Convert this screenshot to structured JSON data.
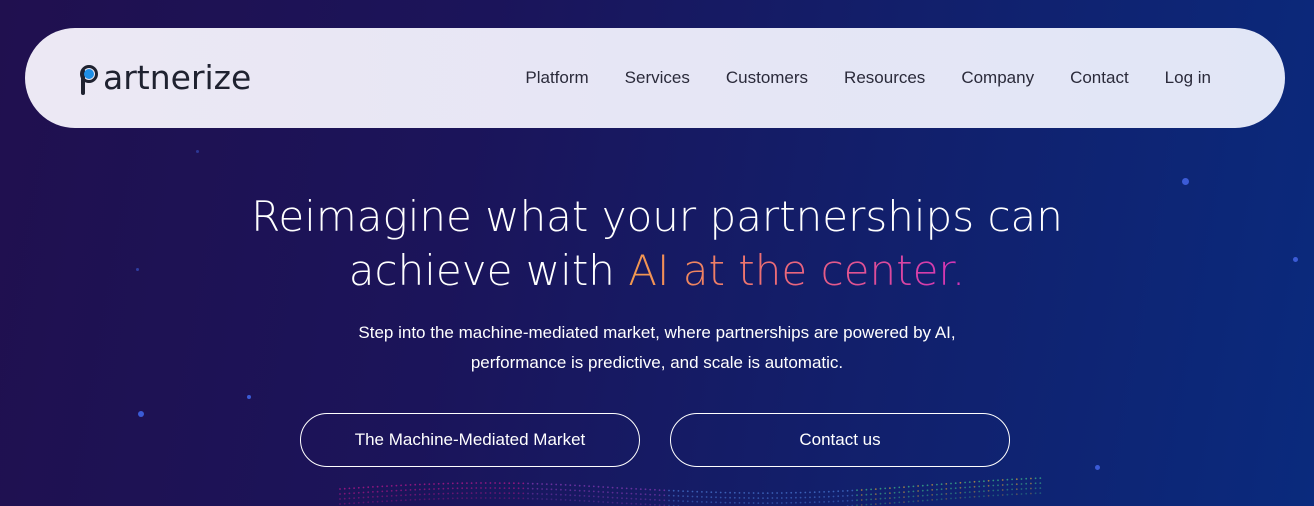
{
  "header": {
    "logo_text": "artnerize",
    "logo_icon": "partnerize-p-logo-icon",
    "nav": [
      {
        "label": "Platform"
      },
      {
        "label": "Services"
      },
      {
        "label": "Customers"
      },
      {
        "label": "Resources"
      },
      {
        "label": "Company"
      },
      {
        "label": "Contact"
      },
      {
        "label": "Log in"
      }
    ]
  },
  "hero": {
    "title_line1": "Reimagine what your partnerships can",
    "title_line2_prefix": "achieve with ",
    "title_line2_highlight": "AI at the center.",
    "subtitle_line1": "Step into the machine-mediated market, where partnerships are powered by AI,",
    "subtitle_line2": "performance is predictive, and scale is automatic.",
    "primary_button": "The Machine-Mediated Market",
    "secondary_button": "Contact us"
  },
  "colors": {
    "background_start": "#20104f",
    "background_end": "#0a2a7d",
    "header_bg": "#e6e6f5",
    "logo_blue": "#1e8fe6",
    "highlight_gradient": [
      "#f39a4e",
      "#ec6a78",
      "#d132b8"
    ]
  }
}
